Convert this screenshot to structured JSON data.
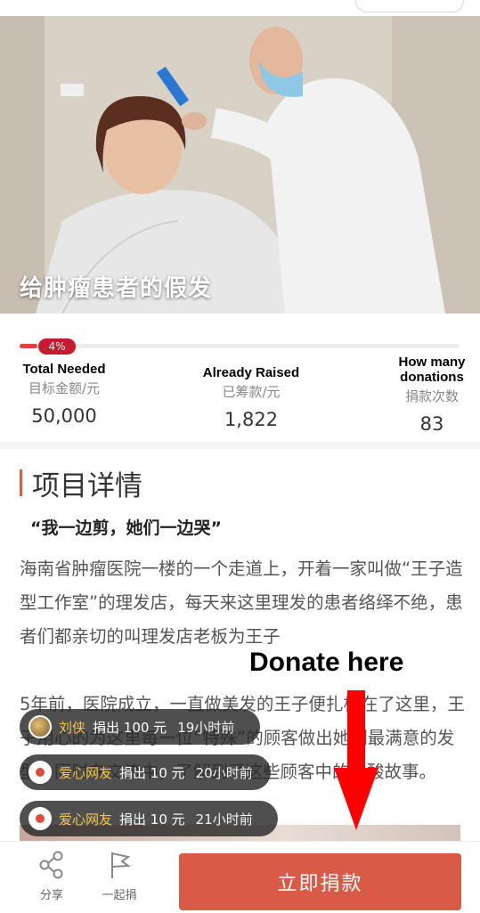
{
  "hero": {
    "title": "给肿瘤患者的假发"
  },
  "progress": {
    "percent_label": "4%",
    "fraction": 0.04,
    "color": "#c9192e"
  },
  "stats": [
    {
      "en": "Total Needed",
      "cn": "目标金额/元",
      "value": "50,000"
    },
    {
      "en": "Already Raised",
      "cn": "已筹款/元",
      "value": "1,822"
    },
    {
      "en": "How many donations",
      "cn": "捐款次数",
      "value": "83"
    }
  ],
  "section": {
    "title": "项目详情"
  },
  "quote": "“我一边剪，她们一边哭”",
  "paragraphs": [
    "海南省肿瘤医院一楼的一个走道上，开着一家叫做“王子造型工作室”的理发店，每天来这里理发的患者络绎不绝，患者们都亲切的叫理发店老板为王子",
    "5年前，医院成立，一直做美发的王子便扎根在了这里，王子用心的为这里每一位“特殊”的顾客做出她们最满意的发型，同时在交流中，了解到了这些顾客中的心酸故事。"
  ],
  "annotation": {
    "label": "Donate here",
    "color": "#ff0000"
  },
  "donations": [
    {
      "name": "刘侠",
      "action": "捐出 100 元",
      "time": "19小时前"
    },
    {
      "name": "爱心网友",
      "action": "捐出 10 元",
      "time": "20小时前"
    },
    {
      "name": "爱心网友",
      "action": "捐出 10 元",
      "time": "21小时前"
    }
  ],
  "bottom_bar": {
    "share_label": "分享",
    "together_label": "一起捐",
    "donate_label": "立即捐款",
    "donate_color": "#d85a47"
  }
}
